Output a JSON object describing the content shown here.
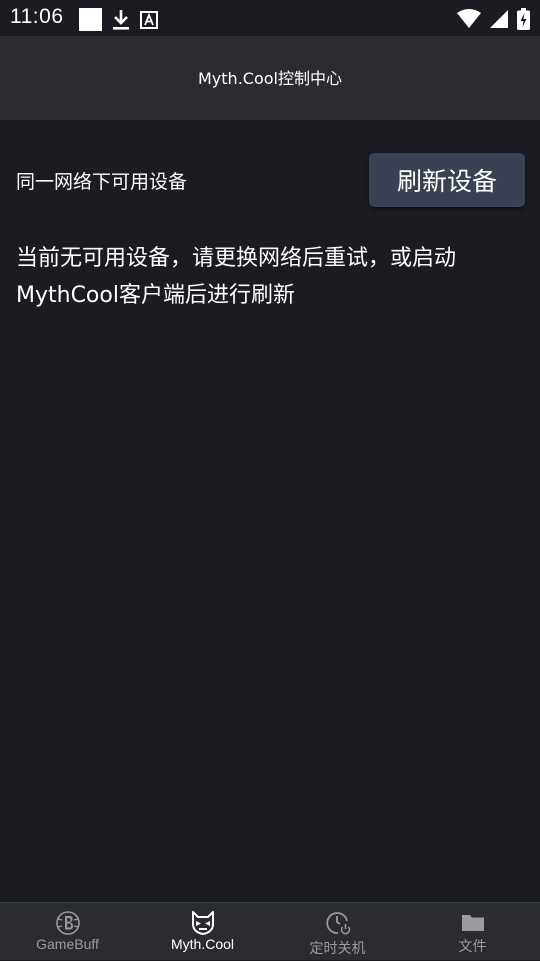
{
  "status_bar": {
    "time": "11:06",
    "icons": [
      "notification-square-icon",
      "download-icon",
      "text-a-icon",
      "wifi-icon",
      "signal-icon",
      "battery-charging-icon"
    ]
  },
  "app_bar": {
    "title": "Myth.Cool控制中心"
  },
  "devices": {
    "section_label": "同一网络下可用设备",
    "refresh_label": "刷新设备",
    "empty_message": "当前无可用设备，请更换网络后重试，或启动MythCool客户端后进行刷新"
  },
  "bottom_nav": {
    "items": [
      {
        "label": "GameBuff",
        "icon": "gamebuff-logo-icon",
        "active": false
      },
      {
        "label": "Myth.Cool",
        "icon": "mythcool-mask-icon",
        "active": true
      },
      {
        "label": "定时关机",
        "icon": "timer-power-icon",
        "active": false
      },
      {
        "label": "文件",
        "icon": "folder-icon",
        "active": false
      }
    ]
  },
  "colors": {
    "background": "#1b1b22",
    "bar": "#2a2c32",
    "button": "#3a4154",
    "inactive_text": "#9a9ba0"
  }
}
